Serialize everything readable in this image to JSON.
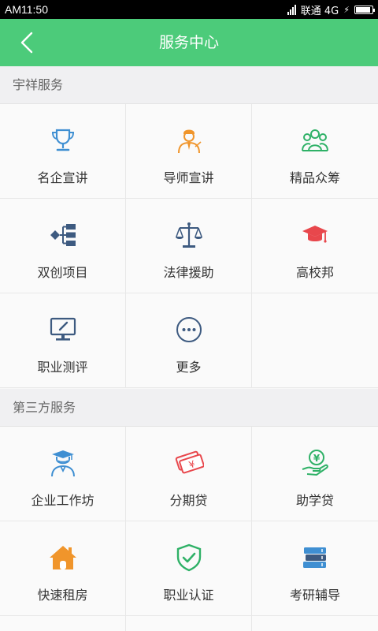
{
  "status_bar": {
    "time": "AM11:50",
    "carrier": "联通 4G",
    "battery_level": 0.9
  },
  "header": {
    "title": "服务中心"
  },
  "sections": [
    {
      "title": "宇祥服务",
      "items": [
        {
          "label": "名企宣讲",
          "icon": "trophy-icon"
        },
        {
          "label": "导师宣讲",
          "icon": "mentor-icon"
        },
        {
          "label": "精品众筹",
          "icon": "group-icon"
        },
        {
          "label": "双创项目",
          "icon": "project-tree-icon"
        },
        {
          "label": "法律援助",
          "icon": "scales-icon"
        },
        {
          "label": "高校邦",
          "icon": "graduation-cap-icon"
        },
        {
          "label": "职业测评",
          "icon": "monitor-pen-icon"
        },
        {
          "label": "更多",
          "icon": "more-dots-icon"
        }
      ]
    },
    {
      "title": "第三方服务",
      "items": [
        {
          "label": "企业工作坊",
          "icon": "graduate-person-icon"
        },
        {
          "label": "分期贷",
          "icon": "money-icon"
        },
        {
          "label": "助学贷",
          "icon": "yuan-hand-icon"
        },
        {
          "label": "快速租房",
          "icon": "house-icon"
        },
        {
          "label": "职业认证",
          "icon": "shield-check-icon"
        },
        {
          "label": "考研辅导",
          "icon": "books-icon"
        }
      ]
    }
  ],
  "colors": {
    "header_green": "#4ccb7a",
    "blue_icon": "#3f8fd2",
    "orange_icon": "#f0952b",
    "green_icon": "#2fb167",
    "navy_icon": "#3d5a80",
    "red_icon": "#e8474c"
  }
}
